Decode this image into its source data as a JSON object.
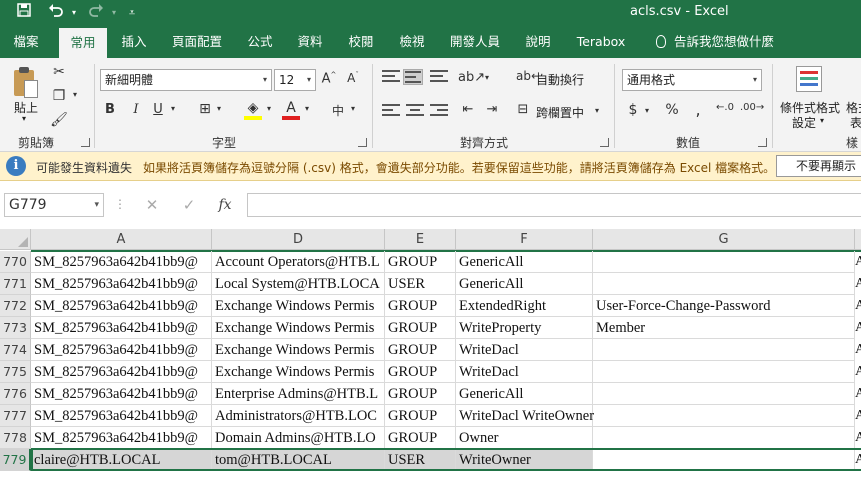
{
  "app": {
    "title": "acls.csv  -  Excel",
    "quick_access": [
      "save-icon",
      "undo-icon",
      "redo-icon",
      "customize-icon"
    ]
  },
  "tabs": [
    {
      "id": "file",
      "label": "檔案"
    },
    {
      "id": "home",
      "label": "常用",
      "active": true
    },
    {
      "id": "insert",
      "label": "插入"
    },
    {
      "id": "layout",
      "label": "頁面配置"
    },
    {
      "id": "formulas",
      "label": "公式"
    },
    {
      "id": "data",
      "label": "資料"
    },
    {
      "id": "review",
      "label": "校閱"
    },
    {
      "id": "view",
      "label": "檢視"
    },
    {
      "id": "developer",
      "label": "開發人員"
    },
    {
      "id": "help",
      "label": "說明"
    },
    {
      "id": "terabox",
      "label": "Terabox"
    },
    {
      "id": "tellme",
      "label": "告訴我您想做什麼"
    }
  ],
  "ribbon": {
    "clipboard": {
      "paste_label": "貼上",
      "group_label": "剪貼簿"
    },
    "font": {
      "name": "新細明體",
      "size": "12",
      "group_label": "字型"
    },
    "alignment": {
      "wrap_label": "自動換行",
      "merge_label": "跨欄置中",
      "group_label": "對齊方式"
    },
    "number": {
      "format": "通用格式",
      "group_label": "數值"
    },
    "styles": {
      "cond_line1": "條件式格式",
      "cond_line2": "設定",
      "fmt_line1": "格式",
      "fmt_line2": "表",
      "group_label": "樣"
    }
  },
  "infobar": {
    "title": "可能發生資料遺失",
    "message": "如果將活頁簿儲存為逗號分隔 (.csv) 格式，會遺失部分功能。若要保留這些功能，請將活頁簿儲存為 Excel 檔案格式。",
    "button": "不要再顯示"
  },
  "formula_bar": {
    "name_box": "G779",
    "cancel": "✕",
    "enter": "✓",
    "fx": "fx",
    "formula": ""
  },
  "grid": {
    "columns": [
      "A",
      "D",
      "E",
      "F",
      "G"
    ],
    "selected_row": "779",
    "rows": [
      {
        "n": "770",
        "a": "SM_8257963a642b41bb9@",
        "d": "Account Operators@HTB.L",
        "e": "GROUP",
        "f": "GenericAll",
        "g": ""
      },
      {
        "n": "771",
        "a": "SM_8257963a642b41bb9@",
        "d": "Local System@HTB.LOCA",
        "e": "USER",
        "f": "GenericAll",
        "g": ""
      },
      {
        "n": "772",
        "a": "SM_8257963a642b41bb9@",
        "d": "Exchange Windows Permis",
        "e": "GROUP",
        "f": "ExtendedRight",
        "g": "User-Force-Change-Password"
      },
      {
        "n": "773",
        "a": "SM_8257963a642b41bb9@",
        "d": "Exchange Windows Permis",
        "e": "GROUP",
        "f": "WriteProperty",
        "g": "Member"
      },
      {
        "n": "774",
        "a": "SM_8257963a642b41bb9@",
        "d": "Exchange Windows Permis",
        "e": "GROUP",
        "f": "WriteDacl",
        "g": ""
      },
      {
        "n": "775",
        "a": "SM_8257963a642b41bb9@",
        "d": "Exchange Windows Permis",
        "e": "GROUP",
        "f": "WriteDacl",
        "g": ""
      },
      {
        "n": "776",
        "a": "SM_8257963a642b41bb9@",
        "d": "Enterprise Admins@HTB.L",
        "e": "GROUP",
        "f": "GenericAll",
        "g": ""
      },
      {
        "n": "777",
        "a": "SM_8257963a642b41bb9@",
        "d": "Administrators@HTB.LOC",
        "e": "GROUP",
        "f": "WriteDacl WriteOwner",
        "g": ""
      },
      {
        "n": "778",
        "a": "SM_8257963a642b41bb9@",
        "d": "Domain Admins@HTB.LO",
        "e": "GROUP",
        "f": "Owner",
        "g": ""
      },
      {
        "n": "779",
        "a": "claire@HTB.LOCAL",
        "d": "tom@HTB.LOCAL",
        "e": "USER",
        "f": "WriteOwner",
        "g": ""
      }
    ],
    "edge_char": "A"
  },
  "colors": {
    "accent": "#217346",
    "infobar_bg": "#fff2cc",
    "selection": "#d6d6d6"
  }
}
